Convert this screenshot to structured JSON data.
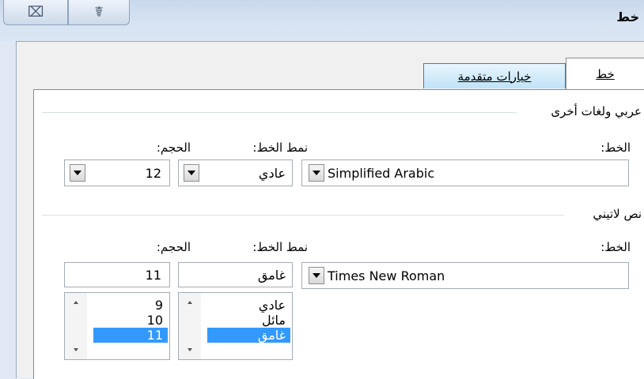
{
  "window": {
    "title": "خط",
    "close_glyph": "⌧",
    "help_glyph": "☤"
  },
  "tabs": [
    {
      "label": "خط",
      "active": true
    },
    {
      "label": "خيارات متقدمة",
      "active": false
    }
  ],
  "arabic_group": {
    "title": "عربي ولغات أخرى",
    "font_label": "الخط:",
    "style_label": "نمط الخط:",
    "size_label": "الحجم:",
    "font_value": "Simplified Arabic",
    "style_value": "عادي",
    "size_value": "12"
  },
  "latin_group": {
    "title": "نص لاتيني",
    "font_label": "الخط:",
    "style_label": "نمط الخط:",
    "size_label": "الحجم:",
    "font_value": "Times New Roman",
    "style_value": "غامق",
    "size_value": "11",
    "style_options": [
      "عادي",
      "مائل",
      "غامق"
    ],
    "size_options": [
      "9",
      "10",
      "11"
    ]
  }
}
